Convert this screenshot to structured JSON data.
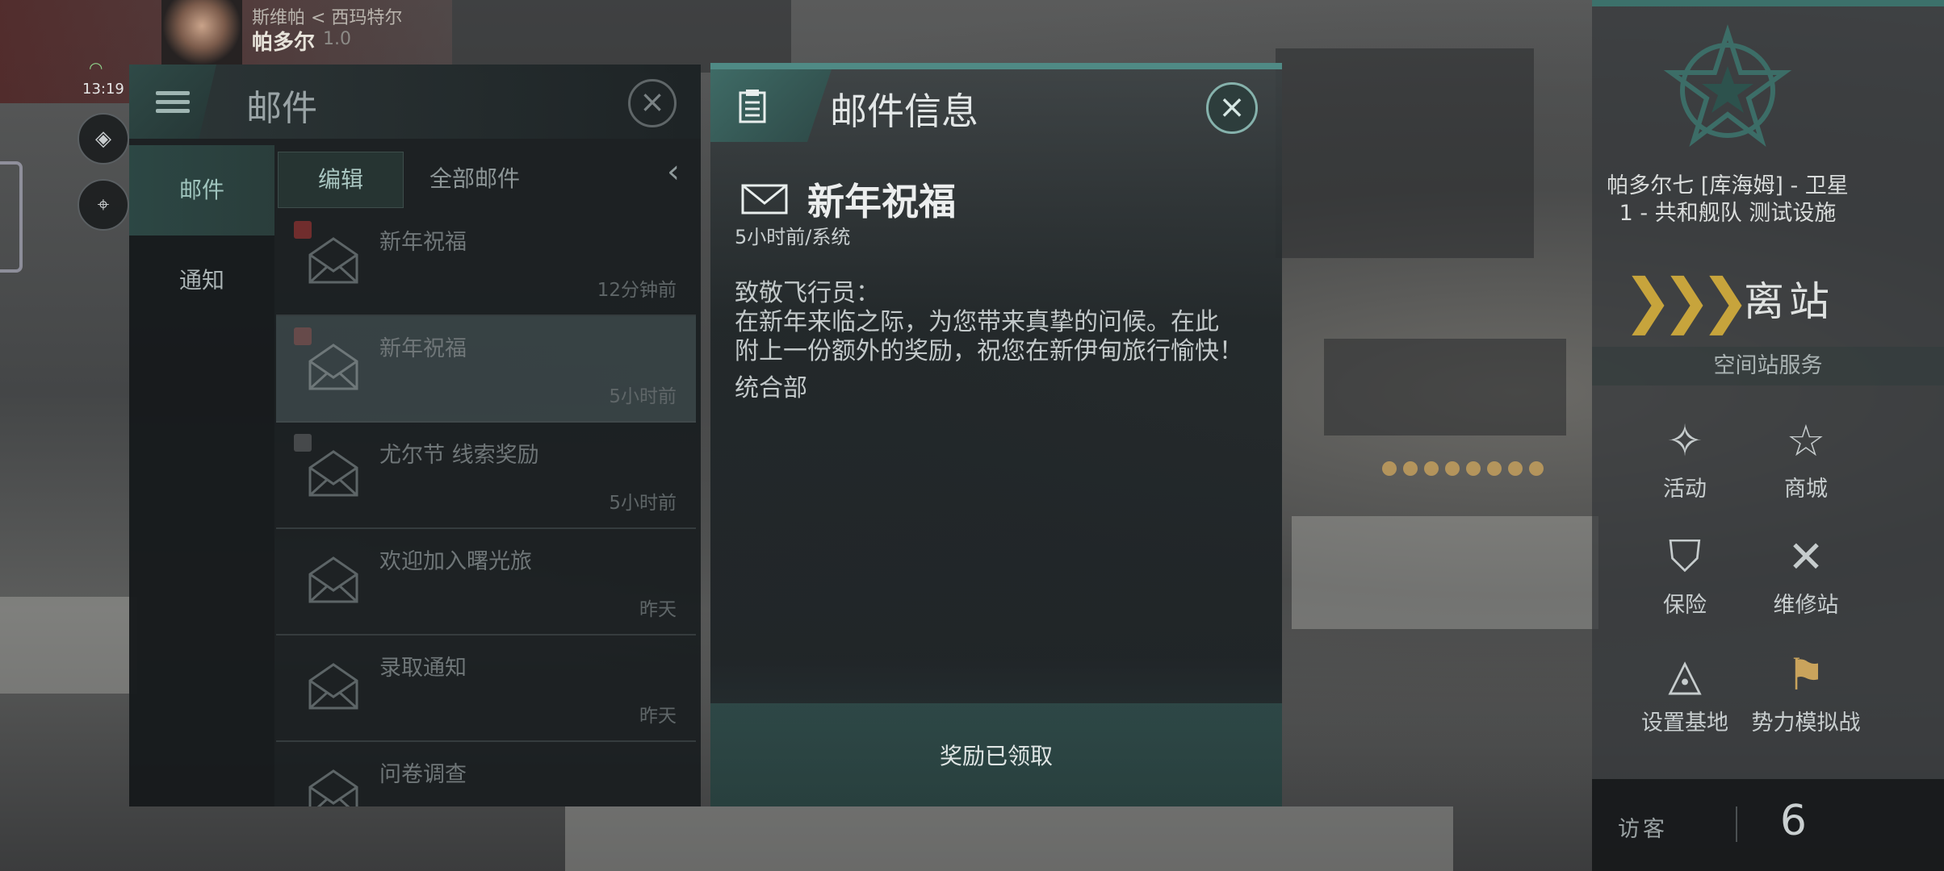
{
  "hud": {
    "top_name": "斯维帕 < 西玛特尔",
    "name": "帕多尔",
    "name_sub": "1.0",
    "time": "13:19"
  },
  "mail_panel": {
    "title": "邮件",
    "categories": [
      {
        "label": "邮件"
      },
      {
        "label": "通知"
      }
    ],
    "edit_label": "编辑",
    "filter_label": "全部邮件",
    "items": [
      {
        "title": "新年祝福",
        "time": "12分钟前"
      },
      {
        "title": "新年祝福",
        "time": "5小时前"
      },
      {
        "title": "尤尔节 线索奖励",
        "time": "5小时前"
      },
      {
        "title": "欢迎加入曙光旅",
        "time": "昨天"
      },
      {
        "title": "录取通知",
        "time": "昨天"
      },
      {
        "title": "问卷调查",
        "time": ""
      }
    ]
  },
  "detail": {
    "title": "邮件信息",
    "subject": "新年祝福",
    "meta": "5小时前/系统",
    "body": [
      "致敬飞行员：",
      "在新年来临之际，为您带来真挚的问候。在此",
      "附上一份额外的奖励，祝您在新伊甸旅行愉快！"
    ],
    "signature": "统合部",
    "footer": "奖励已领取"
  },
  "sidebar": {
    "location_line1": "帕多尔七 [库海姆] - 卫星",
    "location_line2": "1 - 共和舰队 测试设施",
    "depart_label": "离站",
    "services_title": "空间站服务",
    "services": [
      {
        "label": "活动",
        "icon": "party-popper-icon"
      },
      {
        "label": "商城",
        "icon": "star-shop-icon"
      },
      {
        "label": "保险",
        "icon": "shield-icon"
      },
      {
        "label": "维修站",
        "icon": "wrench-icon"
      },
      {
        "label": "设置基地",
        "icon": "base-icon"
      },
      {
        "label": "势力模拟战",
        "icon": "crossed-flags-icon"
      }
    ],
    "visitor_label": "访客",
    "visitor_count": "6"
  },
  "colors": {
    "accent_teal": "#4f8a85",
    "gold": "#c7a43c"
  }
}
